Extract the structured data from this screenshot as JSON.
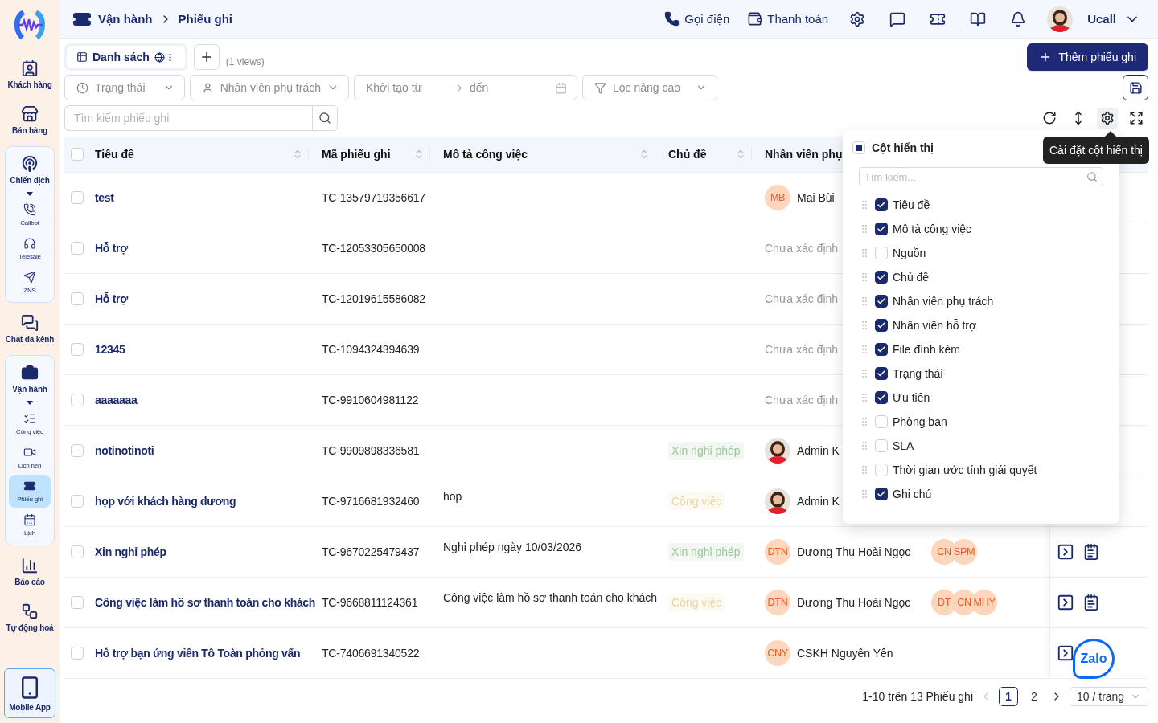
{
  "sidebar": {
    "items": [
      {
        "label": "Khách hàng",
        "kind": "contacts",
        "selected": false
      },
      {
        "label": "Bán hàng",
        "kind": "store",
        "selected": false
      },
      {
        "label": "Chiến dịch",
        "kind": "campaign",
        "selected": false,
        "expanded": true,
        "children": [
          {
            "label": "Callbot",
            "kind": "callbot",
            "selected": false
          },
          {
            "label": "Telesale",
            "kind": "telesale",
            "selected": false
          },
          {
            "label": "ZNS",
            "kind": "zns",
            "selected": false
          }
        ]
      },
      {
        "label": "Chat đa kênh",
        "kind": "chat",
        "selected": false
      },
      {
        "label": "Vận hành",
        "kind": "operations",
        "selected": false,
        "expanded": true,
        "children": [
          {
            "label": "Công việc",
            "kind": "tasks",
            "selected": false
          },
          {
            "label": "Lịch hẹn",
            "kind": "meetings",
            "selected": false
          },
          {
            "label": "Phiếu ghi",
            "kind": "tickets",
            "selected": true
          },
          {
            "label": "Lịch",
            "kind": "calendar",
            "selected": false
          }
        ]
      },
      {
        "label": "Báo cáo",
        "kind": "reports",
        "selected": false
      },
      {
        "label": "Tự động hoá",
        "kind": "automation",
        "selected": false
      }
    ],
    "mobile_app": {
      "label": "Mobile App"
    }
  },
  "header": {
    "breadcrumb": [
      "Vận hành",
      "Phiếu ghi"
    ],
    "actions": [
      {
        "label": "Gọi điện",
        "kind": "call"
      },
      {
        "label": "Thanh toán",
        "kind": "payment"
      }
    ],
    "user": {
      "name": "Ucall"
    }
  },
  "views": {
    "tabs": [
      {
        "label": "Danh sách",
        "selected": true
      }
    ],
    "count": "(1 views)"
  },
  "add_button": "Thêm phiếu ghi",
  "filters": [
    {
      "kind": "status",
      "placeholder": "Trạng thái"
    },
    {
      "kind": "assignee",
      "placeholder": "Nhân viên phụ trách"
    },
    {
      "kind": "daterange",
      "placeholder": "Khởi tạo từ",
      "to_placeholder": "đến"
    },
    {
      "kind": "advanced",
      "placeholder": "Lọc nâng cao"
    }
  ],
  "search": {
    "placeholder": "Tìm kiếm phiếu ghi"
  },
  "table_tools": [
    {
      "kind": "refresh",
      "selected": false
    },
    {
      "kind": "row-height",
      "selected": false
    },
    {
      "kind": "settings",
      "selected": true
    },
    {
      "kind": "fullscreen",
      "selected": false
    }
  ],
  "table": {
    "all_checked": false,
    "columns": [
      {
        "label": "Tiêu đề"
      },
      {
        "label": "Mã phiếu ghi"
      },
      {
        "label": "Mô tả công việc"
      },
      {
        "label": "Chủ đề"
      },
      {
        "label": "Nhân viên phụ"
      }
    ],
    "rows": [
      {
        "checked": false,
        "title": "test",
        "code": "TC-13579719356617",
        "assignee": {
          "kind": "initials",
          "initials": "MB",
          "name": "Mai Bùi"
        }
      },
      {
        "checked": false,
        "title": "Hỗ trợ",
        "code": "TC-12053305650008",
        "assignee": {
          "kind": "unassigned",
          "name": "Chưa xác định"
        }
      },
      {
        "checked": false,
        "title": "Hỗ trợ",
        "code": "TC-12019615586082",
        "assignee": {
          "kind": "unassigned",
          "name": "Chưa xác định"
        }
      },
      {
        "checked": false,
        "title": "12345",
        "code": "TC-1094324394639",
        "assignee": {
          "kind": "unassigned",
          "name": "Chưa xác định"
        }
      },
      {
        "checked": false,
        "title": "aaaaaaa",
        "code": "TC-9910604981122",
        "assignee": {
          "kind": "unassigned",
          "name": "Chưa xác định"
        }
      },
      {
        "checked": false,
        "title": "notinotinoti",
        "code": "TC-9909898336581",
        "topic": {
          "label": "Xin nghỉ phép",
          "color": "#9cc69a"
        },
        "assignee": {
          "kind": "photo",
          "name": "Admin K"
        }
      },
      {
        "checked": false,
        "title": "họp với khách hàng dương",
        "code": "TC-9716681932460",
        "description": "hop",
        "topic": {
          "label": "Công việc",
          "color": "#e6d7a6"
        },
        "assignee": {
          "kind": "photo",
          "name": "Admin K"
        }
      },
      {
        "checked": false,
        "title": "Xin nghỉ phép",
        "code": "TC-9670225479437",
        "description": "Nghỉ phép ngày 10/03/2026",
        "topic": {
          "label": "Xin nghỉ phép",
          "color": "#9cc69a"
        },
        "assignee": {
          "kind": "initials",
          "initials": "DTN",
          "name": "Dương Thu Hoài Ngọc"
        },
        "supporters": [
          "CN",
          "SPM"
        ],
        "actions": [
          {
            "kind": "open"
          },
          {
            "kind": "schedule"
          }
        ]
      },
      {
        "checked": false,
        "title": "Công việc làm hồ sơ thanh toán cho khách",
        "code": "TC-9668811124361",
        "description": "Công việc làm hồ sơ thanh toán cho khách",
        "topic": {
          "label": "Công việc",
          "color": "#e6d7a6"
        },
        "assignee": {
          "kind": "initials",
          "initials": "DTN",
          "name": "Dương Thu Hoài Ngọc"
        },
        "supporters": [
          "DT",
          "CN",
          "MHY"
        ],
        "actions": [
          {
            "kind": "open"
          },
          {
            "kind": "schedule"
          }
        ]
      },
      {
        "checked": false,
        "title": "Hỗ trợ bạn ứng viên Tô Toàn phỏng vấn",
        "code": "TC-7406691340522",
        "assignee": {
          "kind": "initials",
          "initials": "CNY",
          "name": "CSKH Nguyễn Yên"
        },
        "actions": [
          {
            "kind": "open"
          }
        ]
      }
    ]
  },
  "pagination": {
    "summary": "1-10 trên 13 Phiếu ghi",
    "prev_disabled": true,
    "pages": [
      {
        "label": "1",
        "selected": true
      },
      {
        "label": "2",
        "selected": false
      }
    ],
    "page_size": "10 / trang"
  },
  "column_settings": {
    "title": "Cột hiển thị",
    "indeterminate": true,
    "search_placeholder": "Tìm kiếm...",
    "items": [
      {
        "label": "Tiêu đề",
        "checked": true
      },
      {
        "label": "Mô tả công việc",
        "checked": true
      },
      {
        "label": "Nguồn",
        "checked": false
      },
      {
        "label": "Chủ đề",
        "checked": true
      },
      {
        "label": "Nhân viên phụ trách",
        "checked": true
      },
      {
        "label": "Nhân viên hỗ trợ",
        "checked": true
      },
      {
        "label": "File đính kèm",
        "checked": true
      },
      {
        "label": "Trạng thái",
        "checked": true
      },
      {
        "label": "Ưu tiên",
        "checked": true
      },
      {
        "label": "Phòng ban",
        "checked": false
      },
      {
        "label": "SLA",
        "checked": false
      },
      {
        "label": "Thời gian ước tính giải quyết",
        "checked": false
      },
      {
        "label": "Ghi chú",
        "checked": true
      }
    ]
  },
  "tooltip": {
    "text": "Cài đặt cột hiển thị"
  },
  "chat_widget": {
    "label": "Zalo"
  }
}
